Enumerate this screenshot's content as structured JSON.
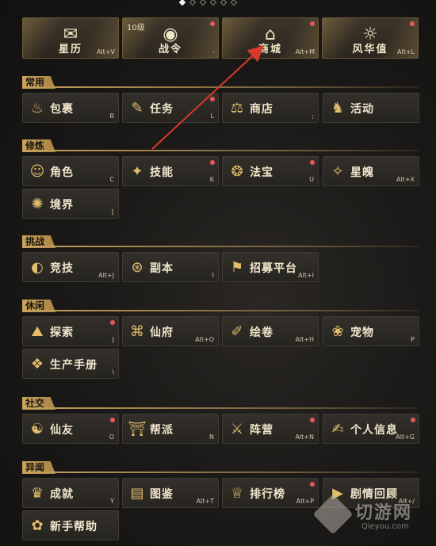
{
  "pagination": {
    "total": 6,
    "active": 0
  },
  "top_buttons": [
    {
      "label": "星历",
      "hotkey": "Alt+V",
      "icon": "scroll-icon",
      "glyph": "✉",
      "badge": false
    },
    {
      "label": "战令",
      "hotkey": "-",
      "icon": "token-icon",
      "glyph": "◉",
      "badge": true,
      "level": "10级"
    },
    {
      "label": "商城",
      "hotkey": "Alt+M",
      "icon": "shop-sign-icon",
      "glyph": "⌂",
      "badge": true
    },
    {
      "label": "风华值",
      "hotkey": "Alt+L",
      "icon": "spirit-icon",
      "glyph": "☼",
      "badge": true
    }
  ],
  "sections": [
    {
      "title": "常用",
      "items": [
        {
          "label": "包裹",
          "hotkey": "B",
          "icon": "bag-icon",
          "glyph": "♨",
          "badge": false
        },
        {
          "label": "任务",
          "hotkey": "L",
          "icon": "scroll-task-icon",
          "glyph": "✎",
          "badge": true
        },
        {
          "label": "商店",
          "hotkey": ";",
          "icon": "scale-icon",
          "glyph": "⚖",
          "badge": false
        },
        {
          "label": "活动",
          "hotkey": "",
          "icon": "lion-icon",
          "glyph": "♞",
          "badge": false
        }
      ]
    },
    {
      "title": "修炼",
      "items": [
        {
          "label": "角色",
          "hotkey": "C",
          "icon": "character-icon",
          "glyph": "☺",
          "badge": false
        },
        {
          "label": "技能",
          "hotkey": "K",
          "icon": "skill-icon",
          "glyph": "✦",
          "badge": true
        },
        {
          "label": "法宝",
          "hotkey": "U",
          "icon": "treasure-icon",
          "glyph": "❂",
          "badge": true
        },
        {
          "label": "星魄",
          "hotkey": "Alt+X",
          "icon": "star-soul-icon",
          "glyph": "✧",
          "badge": false
        },
        {
          "label": "境界",
          "hotkey": "[",
          "icon": "realm-icon",
          "glyph": "✺",
          "badge": false
        }
      ]
    },
    {
      "title": "挑战",
      "items": [
        {
          "label": "竞技",
          "hotkey": "Alt+J",
          "icon": "arena-icon",
          "glyph": "◐",
          "badge": false
        },
        {
          "label": "副本",
          "hotkey": "I",
          "icon": "dungeon-icon",
          "glyph": "⊛",
          "badge": false
        },
        {
          "label": "招募平台",
          "hotkey": "Alt+I",
          "icon": "recruit-icon",
          "glyph": "⚑",
          "badge": false
        }
      ]
    },
    {
      "title": "休闲",
      "items": [
        {
          "label": "探索",
          "hotkey": "J",
          "icon": "explore-icon",
          "glyph": "⛰",
          "badge": true
        },
        {
          "label": "仙府",
          "hotkey": "Alt+O",
          "icon": "mansion-icon",
          "glyph": "⌘",
          "badge": false
        },
        {
          "label": "绘卷",
          "hotkey": "Alt+H",
          "icon": "painting-icon",
          "glyph": "✐",
          "badge": false
        },
        {
          "label": "宠物",
          "hotkey": "P",
          "icon": "pet-icon",
          "glyph": "❀",
          "badge": false
        },
        {
          "label": "生产手册",
          "hotkey": "\\",
          "icon": "craft-icon",
          "glyph": "❖",
          "badge": false
        }
      ]
    },
    {
      "title": "社交",
      "items": [
        {
          "label": "仙友",
          "hotkey": "O",
          "icon": "friends-icon",
          "glyph": "☯",
          "badge": true
        },
        {
          "label": "帮派",
          "hotkey": "N",
          "icon": "guild-icon",
          "glyph": "⛩",
          "badge": false
        },
        {
          "label": "阵营",
          "hotkey": "Alt+N",
          "icon": "faction-icon",
          "glyph": "⚔",
          "badge": true
        },
        {
          "label": "个人信息",
          "hotkey": "Alt+G",
          "icon": "profile-icon",
          "glyph": "✍",
          "badge": true
        }
      ]
    },
    {
      "title": "异闻",
      "items": [
        {
          "label": "成就",
          "hotkey": "Y",
          "icon": "achievement-icon",
          "glyph": "♛",
          "badge": false
        },
        {
          "label": "图鉴",
          "hotkey": "Alt+T",
          "icon": "codex-icon",
          "glyph": "▤",
          "badge": false
        },
        {
          "label": "排行榜",
          "hotkey": "Alt+P",
          "icon": "trophy-icon",
          "glyph": "♕",
          "badge": true
        },
        {
          "label": "剧情回顾",
          "hotkey": "Alt+/",
          "icon": "story-replay-icon",
          "glyph": "▶",
          "badge": false
        },
        {
          "label": "新手帮助",
          "hotkey": "",
          "icon": "help-icon",
          "glyph": "✿",
          "badge": false
        }
      ]
    }
  ],
  "watermark": {
    "text": "切游网",
    "sub": "Qieyou.com"
  },
  "colors": {
    "accent": "#c9a35c",
    "badge": "#e85a5a",
    "arrow": "#d83a2a"
  }
}
